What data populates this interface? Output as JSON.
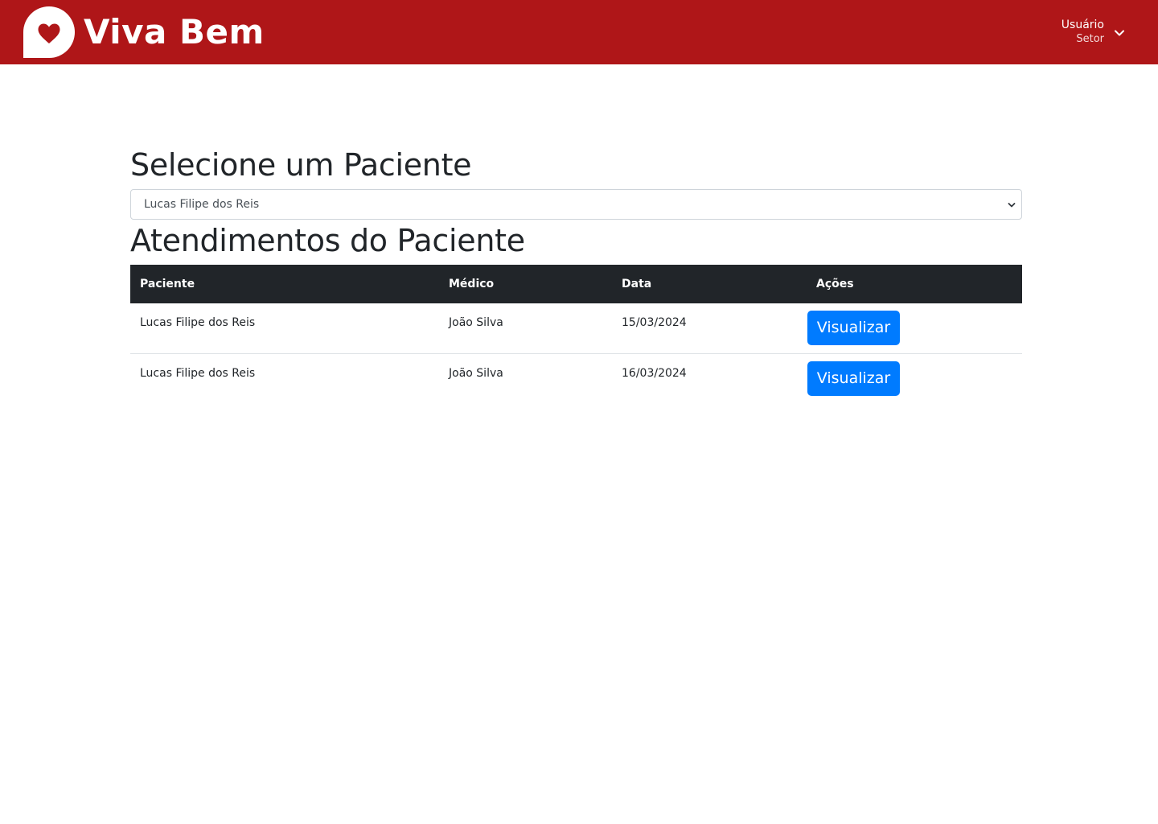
{
  "header": {
    "brand": "Viva Bem",
    "user": {
      "name": "Usuário",
      "sector": "Setor"
    },
    "colors": {
      "bar": "#af1618",
      "heart": "#af1618"
    }
  },
  "patient_select": {
    "heading": "Selecione um Paciente",
    "selected_value": "Lucas Filipe dos Reis"
  },
  "appointments": {
    "heading": "Atendimentos do Paciente",
    "columns": [
      "Paciente",
      "Médico",
      "Data",
      "Ações"
    ],
    "rows": [
      {
        "paciente": "Lucas Filipe dos Reis",
        "medico": "João Silva",
        "data": "15/03/2024",
        "acao": "Visualizar"
      },
      {
        "paciente": "Lucas Filipe dos Reis",
        "medico": "João Silva",
        "data": "16/03/2024",
        "acao": "Visualizar"
      }
    ]
  },
  "icons": {
    "logo": "heart-speech-bubble-icon",
    "user_menu": "chevron-down-icon",
    "select": "chevron-down-icon"
  },
  "accent_button": "#007bff"
}
